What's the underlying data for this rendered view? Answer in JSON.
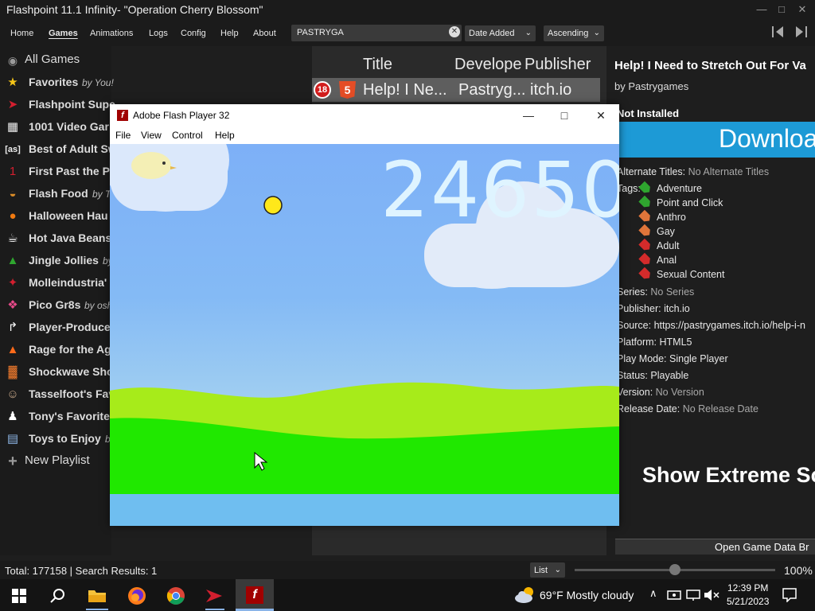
{
  "window": {
    "title": "Flashpoint 11.1 Infinity- \"Operation Cherry Blossom\""
  },
  "menu": {
    "items": [
      "Home",
      "Games",
      "Animations",
      "Logs",
      "Config",
      "Help",
      "About"
    ],
    "active": "Games"
  },
  "search": {
    "value": "PASTRYGA"
  },
  "sort": {
    "field": "Date Added",
    "order": "Ascending"
  },
  "sidebar": {
    "all_games": "All Games",
    "playlists": [
      {
        "name": "Favorites",
        "author": "by You!",
        "icon": "star-icon"
      },
      {
        "name": "Flashpoint Supe",
        "author": "",
        "icon": "flashpoint-logo-icon"
      },
      {
        "name": "1001 Video Gar",
        "author": "",
        "icon": "space-invader-icon"
      },
      {
        "name": "Best of Adult Sw",
        "author": "",
        "icon": "as-logo-icon"
      },
      {
        "name": "First Past the Po",
        "author": "",
        "icon": "number-one-icon"
      },
      {
        "name": "Flash Food",
        "author": "by Th",
        "icon": "burger-icon"
      },
      {
        "name": "Halloween Hau",
        "author": "",
        "icon": "pumpkin-icon"
      },
      {
        "name": "Hot Java Beans",
        "author": "",
        "icon": "cup-icon"
      },
      {
        "name": "Jingle Jollies",
        "author": "by",
        "icon": "tree-icon"
      },
      {
        "name": "Molleindustria'",
        "author": "",
        "icon": "molleindustria-icon"
      },
      {
        "name": "Pico Gr8s",
        "author": "by osh",
        "icon": "pico-icon"
      },
      {
        "name": "Player-Produce",
        "author": "",
        "icon": "share-arrow-icon"
      },
      {
        "name": "Rage for the Ag",
        "author": "",
        "icon": "fire-icon"
      },
      {
        "name": "Shockwave Sho",
        "author": "",
        "icon": "shockwave-icon"
      },
      {
        "name": "Tasselfoot's Fav",
        "author": "",
        "icon": "avatar-icon"
      },
      {
        "name": "Tony's Favorites",
        "author": "",
        "icon": "silhouette-icon"
      },
      {
        "name": "Toys to Enjoy",
        "author": "by",
        "icon": "blocks-icon"
      }
    ],
    "new_playlist": "New Playlist"
  },
  "list": {
    "columns": [
      "Title",
      "Develope",
      "Publisher"
    ],
    "row": {
      "age_rating": "18",
      "platform_icon": "5",
      "title": "Help! I Ne...",
      "developer": "Pastryg...",
      "publisher": "itch.io"
    }
  },
  "detail": {
    "title": "Help! I Need to Stretch Out For Va",
    "by": "by Pastrygames",
    "install_status": "Not Installed",
    "download_label": "Downloa",
    "alt_titles_label": "Alternate Titles:",
    "alt_titles_value": "No Alternate Titles",
    "tags_label": "Tags:",
    "tags": [
      {
        "name": "Adventure",
        "color": "#2fa52f"
      },
      {
        "name": "Point and Click",
        "color": "#2fa52f"
      },
      {
        "name": "Anthro",
        "color": "#e0753a"
      },
      {
        "name": "Gay",
        "color": "#e0753a"
      },
      {
        "name": "Adult",
        "color": "#d42b2b"
      },
      {
        "name": "Anal",
        "color": "#d42b2b"
      },
      {
        "name": "Sexual Content",
        "color": "#d42b2b"
      }
    ],
    "fields": [
      {
        "label": "Series:",
        "value": "No Series",
        "dim": true
      },
      {
        "label": "Publisher:",
        "value": "itch.io",
        "dim": false
      },
      {
        "label": "Source:",
        "value": "https://pastrygames.itch.io/help-i-n",
        "dim": false
      },
      {
        "label": "Platform:",
        "value": "HTML5",
        "dim": false
      },
      {
        "label": "Play Mode:",
        "value": "Single Player",
        "dim": false
      },
      {
        "label": "Status:",
        "value": "Playable",
        "dim": false
      },
      {
        "label": "Version:",
        "value": "No Version",
        "dim": true
      },
      {
        "label": "Release Date:",
        "value": "No Release Date",
        "dim": true
      }
    ],
    "extreme_label": "Show Extreme Sc",
    "open_data_label": "Open Game Data Br"
  },
  "status": {
    "text": "Total: 177158  |  Search Results: 1",
    "view_mode": "List",
    "zoom": "100%",
    "zoom_fraction": 0.5
  },
  "flash": {
    "title": "Adobe Flash Player 32",
    "menu": [
      "File",
      "View",
      "Control",
      "Help"
    ],
    "score": "24650"
  },
  "taskbar": {
    "weather": "69°F  Mostly cloudy",
    "time": "12:39 PM",
    "date": "5/21/2023"
  }
}
